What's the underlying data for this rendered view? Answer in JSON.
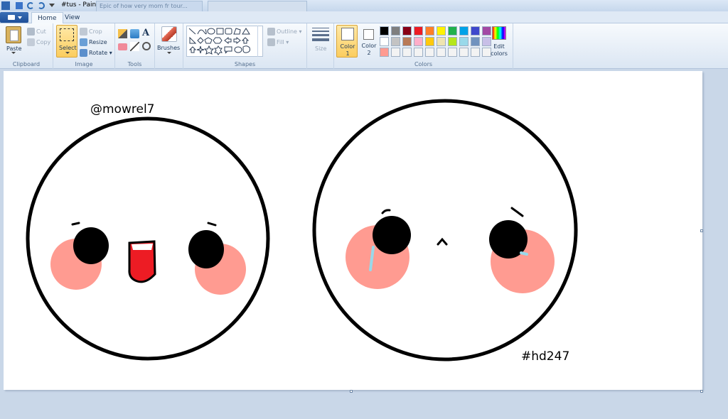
{
  "window": {
    "title": "#tus - Paint",
    "bg_tab_1": "Epic of how very mom fr tour..."
  },
  "menu": {
    "home_tab": "Home",
    "view_tab": "View"
  },
  "clipboard": {
    "paste_label": "Paste",
    "cut_label": "Cut",
    "copy_label": "Copy",
    "group_label": "Clipboard"
  },
  "image": {
    "select_label": "Select",
    "crop_label": "Crop",
    "resize_label": "Resize",
    "rotate_label": "Rotate",
    "group_label": "Image"
  },
  "tools": {
    "group_label": "Tools",
    "text_tool_glyph": "A"
  },
  "brushes": {
    "label": "Brushes"
  },
  "shapes": {
    "outline_label": "Outline",
    "fill_label": "Fill",
    "group_label": "Shapes"
  },
  "size": {
    "label": "Size"
  },
  "colors": {
    "color1_label": "Color 1",
    "color2_label": "Color 2",
    "edit_label": "Edit colors",
    "group_label": "Colors",
    "palette_row1": [
      "#000000",
      "#7f7f7f",
      "#880015",
      "#ed1c24",
      "#ff7f27",
      "#fff200",
      "#22b14c",
      "#00a2e8",
      "#3f48cc",
      "#a349a4"
    ],
    "palette_row2": [
      "#ffffff",
      "#c3c3c3",
      "#b97a57",
      "#ffaec9",
      "#ffc90e",
      "#efe4b0",
      "#b5e61d",
      "#99d9ea",
      "#7092be",
      "#c8bfe7"
    ],
    "palette_row3": [
      "#ff9b91",
      "#f3f3f3",
      "#f3f3f3",
      "#f3f3f3",
      "#f3f3f3",
      "#f3f3f3",
      "#f3f3f3",
      "#f3f3f3",
      "#f3f3f3",
      "#f3f3f3"
    ]
  },
  "drawing": {
    "signature_left": "@mowrel7",
    "signature_right": "#hd247"
  }
}
